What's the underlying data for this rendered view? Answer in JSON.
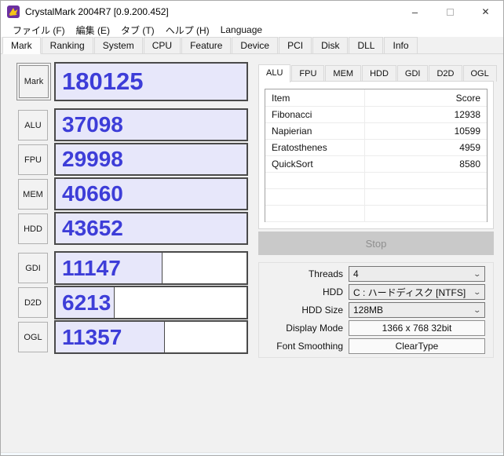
{
  "window": {
    "title": "CrystalMark 2004R7 [0.9.200.452]",
    "controls": {
      "minimize": "–",
      "close": "✕"
    }
  },
  "menu": {
    "items": [
      "ファイル (F)",
      "編集 (E)",
      "タブ (T)",
      "ヘルプ (H)",
      "Language"
    ]
  },
  "main_tabs": {
    "items": [
      "Mark",
      "Ranking",
      "System",
      "CPU",
      "Feature",
      "Device",
      "PCI",
      "Disk",
      "DLL",
      "Info"
    ],
    "active": "Mark"
  },
  "scores": {
    "rows": [
      {
        "label": "Mark",
        "value": "180125",
        "fill_pct": 100
      },
      {
        "label": "ALU",
        "value": "37098",
        "fill_pct": 100
      },
      {
        "label": "FPU",
        "value": "29998",
        "fill_pct": 100
      },
      {
        "label": "MEM",
        "value": "40660",
        "fill_pct": 100
      },
      {
        "label": "HDD",
        "value": "43652",
        "fill_pct": 100
      },
      {
        "label": "GDI",
        "value": "11147",
        "fill_pct": 56
      },
      {
        "label": "D2D",
        "value": "6213",
        "fill_pct": 31
      },
      {
        "label": "OGL",
        "value": "11357",
        "fill_pct": 57
      }
    ]
  },
  "detail": {
    "tabs": {
      "items": [
        "ALU",
        "FPU",
        "MEM",
        "HDD",
        "GDI",
        "D2D",
        "OGL"
      ],
      "active": "ALU"
    },
    "table": {
      "columns": [
        "Item",
        "Score"
      ],
      "rows": [
        {
          "item": "Fibonacci",
          "score": "12938"
        },
        {
          "item": "Napierian",
          "score": "10599"
        },
        {
          "item": "Eratosthenes",
          "score": "4959"
        },
        {
          "item": "QuickSort",
          "score": "8580"
        }
      ]
    }
  },
  "stop": {
    "label": "Stop",
    "enabled": false
  },
  "settings": {
    "rows": [
      {
        "label": "Threads",
        "value": "4",
        "type": "select"
      },
      {
        "label": "HDD",
        "value": "C : ハードディスク [NTFS]",
        "type": "select"
      },
      {
        "label": "HDD Size",
        "value": "128MB",
        "type": "select"
      },
      {
        "label": "Display Mode",
        "value": "1366 x 768 32bit",
        "type": "static"
      },
      {
        "label": "Font Smoothing",
        "value": "ClearType",
        "type": "static"
      }
    ]
  },
  "colors": {
    "score_text": "#3d3dd8",
    "score_fill": "#e7e7fa",
    "disabled_button_bg": "#c9c9c9"
  }
}
